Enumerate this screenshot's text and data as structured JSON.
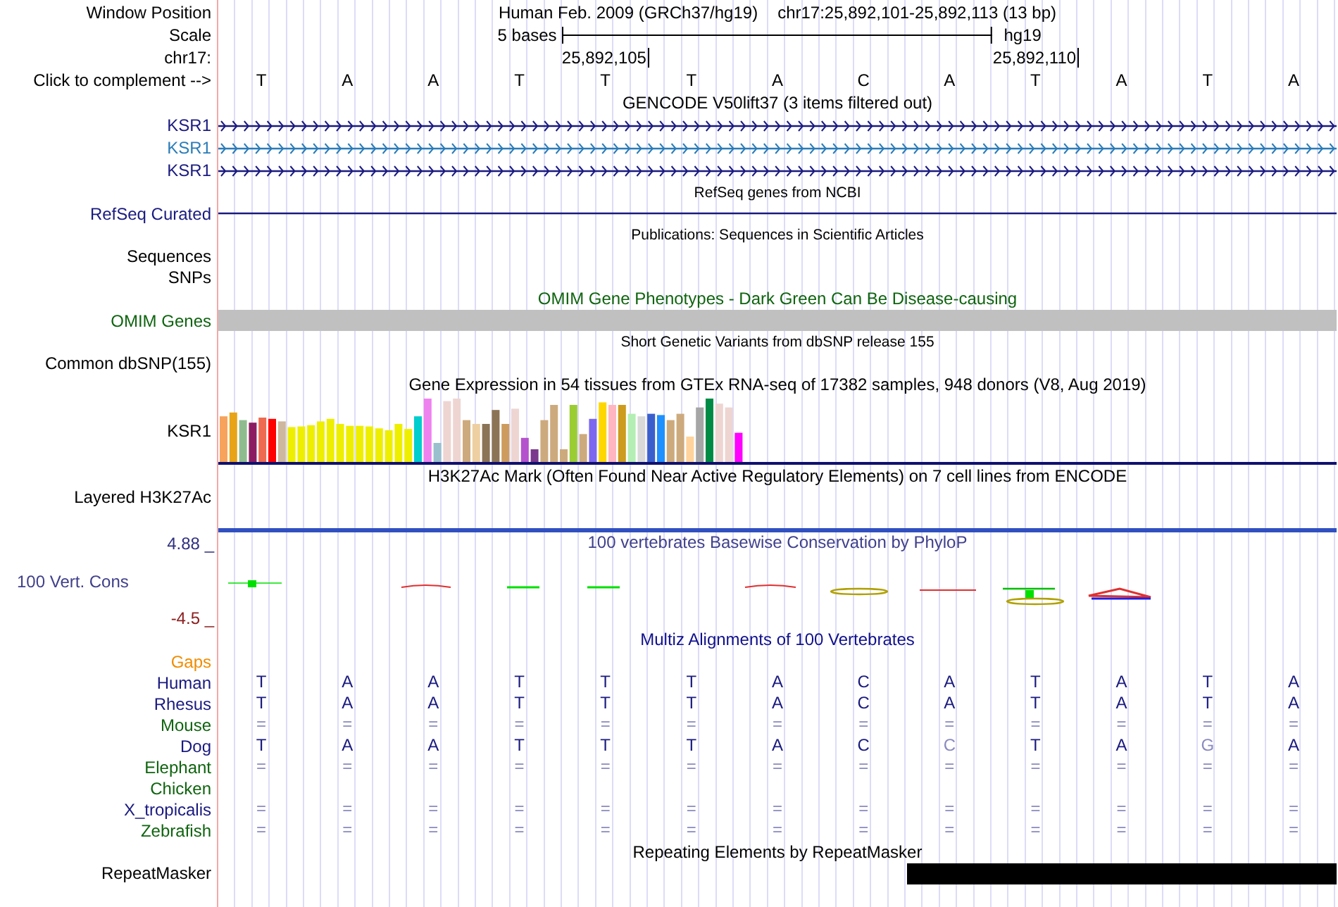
{
  "rows": [
    {
      "kind": "window",
      "label": "Window Position",
      "title": "Human Feb. 2009 (GRCh37/hg19)",
      "position": "chr17:25,892,101-25,892,113 (13 bp)"
    },
    {
      "kind": "scale",
      "label": "Scale",
      "text": "5 bases",
      "assembly": "hg19"
    },
    {
      "kind": "ruler",
      "label": "chr17:",
      "ticks": [
        "25,892,105",
        "25,892,110"
      ]
    },
    {
      "kind": "bases",
      "label": "Click to complement -->",
      "bases": [
        "T",
        "A",
        "A",
        "T",
        "T",
        "T",
        "A",
        "C",
        "A",
        "T",
        "A",
        "T",
        "A"
      ]
    },
    {
      "kind": "title",
      "text": "GENCODE V50lift37 (3 items filtered out)",
      "color": "#000000"
    },
    {
      "kind": "gene",
      "label": "KSR1",
      "color": "#1a1a80"
    },
    {
      "kind": "gene",
      "label": "KSR1",
      "color": "#2a7cb8"
    },
    {
      "kind": "gene",
      "label": "KSR1",
      "color": "#1a1a80"
    },
    {
      "kind": "note",
      "text": "RefSeq genes from NCBI"
    },
    {
      "kind": "gene_line",
      "label": "RefSeq Curated",
      "color": "#1a1a80"
    },
    {
      "kind": "note",
      "text": "Publications: Sequences in Scientific Articles"
    },
    {
      "kind": "empty",
      "label": "Sequences"
    },
    {
      "kind": "empty",
      "label": "SNPs"
    },
    {
      "kind": "title",
      "text": "OMIM Gene Phenotypes - Dark Green Can Be Disease-causing",
      "color": "#0f640f"
    },
    {
      "kind": "bar",
      "label": "OMIM Genes",
      "color": "#0f640f"
    },
    {
      "kind": "note",
      "text": "Short Genetic Variants from dbSNP release 155"
    },
    {
      "kind": "empty",
      "label": "Common dbSNP(155)"
    },
    {
      "kind": "title",
      "text": "Gene Expression in 54 tissues from GTEx RNA-seq of 17382 samples, 948 donors (V8, Aug 2019)",
      "color": "#000000"
    },
    {
      "kind": "expression",
      "label": "KSR1"
    },
    {
      "kind": "title",
      "text": "H3K27Ac Mark (Often Found Near Active Regulatory Elements) on 7 cell lines from ENCODE",
      "color": "#000000"
    },
    {
      "kind": "layered",
      "label": "Layered H3K27Ac"
    },
    {
      "kind": "phylop",
      "label": "100 Vert. Cons",
      "max": "4.88 _",
      "min": "-4.5 _",
      "title": "100 vertebrates Basewise Conservation by PhyloP"
    },
    {
      "kind": "title",
      "text": "Multiz Alignments of 100 Vertebrates",
      "color": "#10108c"
    },
    {
      "kind": "align",
      "label": "Gaps",
      "color": "#f08c00"
    },
    {
      "kind": "align",
      "label": "Human",
      "color": "#1a1a80",
      "bases": [
        {
          "b": "T",
          "faded": false
        },
        {
          "b": "A",
          "faded": false
        },
        {
          "b": "A",
          "faded": false
        },
        {
          "b": "T",
          "faded": false
        },
        {
          "b": "T",
          "faded": false
        },
        {
          "b": "T",
          "faded": false
        },
        {
          "b": "A",
          "faded": false
        },
        {
          "b": "C",
          "faded": false
        },
        {
          "b": "A",
          "faded": false
        },
        {
          "b": "T",
          "faded": false
        },
        {
          "b": "A",
          "faded": false
        },
        {
          "b": "T",
          "faded": false
        },
        {
          "b": "A",
          "faded": false
        }
      ]
    },
    {
      "kind": "align",
      "label": "Rhesus",
      "color": "#1a1a80",
      "bases": [
        {
          "b": "T",
          "faded": false
        },
        {
          "b": "A",
          "faded": false
        },
        {
          "b": "A",
          "faded": false
        },
        {
          "b": "T",
          "faded": false
        },
        {
          "b": "T",
          "faded": false
        },
        {
          "b": "T",
          "faded": false
        },
        {
          "b": "A",
          "faded": false
        },
        {
          "b": "C",
          "faded": false
        },
        {
          "b": "A",
          "faded": false
        },
        {
          "b": "T",
          "faded": false
        },
        {
          "b": "A",
          "faded": false
        },
        {
          "b": "T",
          "faded": false
        },
        {
          "b": "A",
          "faded": false
        }
      ]
    },
    {
      "kind": "align",
      "label": "Mouse",
      "color": "#0f640f",
      "bases": [
        {
          "b": "=",
          "faded": true
        },
        {
          "b": "=",
          "faded": true
        },
        {
          "b": "=",
          "faded": true
        },
        {
          "b": "=",
          "faded": true
        },
        {
          "b": "=",
          "faded": true
        },
        {
          "b": "=",
          "faded": true
        },
        {
          "b": "=",
          "faded": true
        },
        {
          "b": "=",
          "faded": true
        },
        {
          "b": "=",
          "faded": true
        },
        {
          "b": "=",
          "faded": true
        },
        {
          "b": "=",
          "faded": true
        },
        {
          "b": "=",
          "faded": true
        },
        {
          "b": "=",
          "faded": true
        }
      ]
    },
    {
      "kind": "align",
      "label": "Dog",
      "color": "#1a1a80",
      "bases": [
        {
          "b": "T",
          "faded": false
        },
        {
          "b": "A",
          "faded": false
        },
        {
          "b": "A",
          "faded": false
        },
        {
          "b": "T",
          "faded": false
        },
        {
          "b": "T",
          "faded": false
        },
        {
          "b": "T",
          "faded": false
        },
        {
          "b": "A",
          "faded": false
        },
        {
          "b": "C",
          "faded": false
        },
        {
          "b": "C",
          "faded": true
        },
        {
          "b": "T",
          "faded": false
        },
        {
          "b": "A",
          "faded": false
        },
        {
          "b": "G",
          "faded": true
        },
        {
          "b": "A",
          "faded": false
        }
      ]
    },
    {
      "kind": "align",
      "label": "Elephant",
      "color": "#0f640f",
      "bases": [
        {
          "b": "=",
          "faded": true
        },
        {
          "b": "=",
          "faded": true
        },
        {
          "b": "=",
          "faded": true
        },
        {
          "b": "=",
          "faded": true
        },
        {
          "b": "=",
          "faded": true
        },
        {
          "b": "=",
          "faded": true
        },
        {
          "b": "=",
          "faded": true
        },
        {
          "b": "=",
          "faded": true
        },
        {
          "b": "=",
          "faded": true
        },
        {
          "b": "=",
          "faded": true
        },
        {
          "b": "=",
          "faded": true
        },
        {
          "b": "=",
          "faded": true
        },
        {
          "b": "=",
          "faded": true
        }
      ]
    },
    {
      "kind": "align",
      "label": "Chicken",
      "color": "#0f640f"
    },
    {
      "kind": "align",
      "label": "X_tropicalis",
      "color": "#1a1a80",
      "bases": [
        {
          "b": "=",
          "faded": true
        },
        {
          "b": "=",
          "faded": true
        },
        {
          "b": "=",
          "faded": true
        },
        {
          "b": "=",
          "faded": true
        },
        {
          "b": "=",
          "faded": true
        },
        {
          "b": "=",
          "faded": true
        },
        {
          "b": "=",
          "faded": true
        },
        {
          "b": "=",
          "faded": true
        },
        {
          "b": "=",
          "faded": true
        },
        {
          "b": "=",
          "faded": true
        },
        {
          "b": "=",
          "faded": true
        },
        {
          "b": "=",
          "faded": true
        },
        {
          "b": "=",
          "faded": true
        }
      ]
    },
    {
      "kind": "align",
      "label": "Zebrafish",
      "color": "#0f640f",
      "bases": [
        {
          "b": "=",
          "faded": true
        },
        {
          "b": "=",
          "faded": true
        },
        {
          "b": "=",
          "faded": true
        },
        {
          "b": "=",
          "faded": true
        },
        {
          "b": "=",
          "faded": true
        },
        {
          "b": "=",
          "faded": true
        },
        {
          "b": "=",
          "faded": true
        },
        {
          "b": "=",
          "faded": true
        },
        {
          "b": "=",
          "faded": true
        },
        {
          "b": "=",
          "faded": true
        },
        {
          "b": "=",
          "faded": true
        },
        {
          "b": "=",
          "faded": true
        },
        {
          "b": "=",
          "faded": true
        }
      ]
    },
    {
      "kind": "title",
      "text": "Repeating Elements by RepeatMasker",
      "color": "#000000"
    },
    {
      "kind": "repeat",
      "label": "RepeatMasker"
    }
  ]
}
